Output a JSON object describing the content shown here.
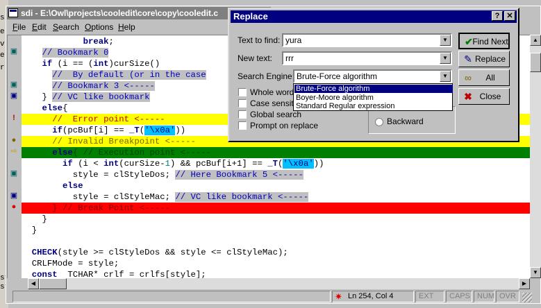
{
  "window": {
    "title": "sdi - E:\\Owl\\projects\\cooledit\\core\\copy\\cooledit.c"
  },
  "menu": {
    "items": [
      "File",
      "Edit",
      "Search",
      "Options",
      "Help"
    ],
    "underline": [
      "F",
      "E",
      "S",
      "O",
      "H"
    ]
  },
  "desktop_fragments": [
    "s",
    "e",
    "v",
    "e",
    "r",
    "st",
    "st"
  ],
  "editor": {
    "lines": [
      "            break;",
      "    // Bookmark 0",
      "    if (i == (int)curSize()",
      "      //  By default (or in the case",
      "      // Bookmark 3 <-----",
      "    } // VC like bookmark",
      "    else{",
      "      //  Error point <-----",
      "      if(pcBuf[i] == _T('\\x0a'))",
      "      // Invalid Breakpoint <-----",
      "      else{ // Execution point <-----",
      "        if (i < int(curSize-1) && pcBuf[i+1] == _T('\\x0a'))",
      "          style = clStyleDos; // Here Bookmark 5 <-----",
      "        else",
      "          style = clStyleMac; // VC like bookmark <-----",
      "      } // Break Point <-----",
      "    }",
      "  }",
      "",
      "  CHECK(style >= clStyleDos && style <= clStyleMac);",
      "  CRLFMode = style;",
      "  const  TCHAR* crlf = crlfs[style];"
    ]
  },
  "status": {
    "position": "Ln 254, Col 4",
    "indicators": [
      "EXT",
      "CAPS",
      "NUM",
      "OVR"
    ]
  },
  "dialog": {
    "title": "Replace",
    "help_glyph": "?",
    "close_glyph": "✕",
    "find_label": "Text to find:",
    "find_value": "yura",
    "new_label": "New text:",
    "new_value": "rrr",
    "engine_label": "Search Engine:",
    "engine_value": "Brute-Force algorithm",
    "engine_options": [
      "Brute-Force algorithm",
      "Boyer-Moore algorithm",
      "Standard Regular expression"
    ],
    "checkboxes": [
      "Whole words",
      "Case sensitiv",
      "Global search",
      "Prompt on replace"
    ],
    "direction_backward": "Backward",
    "buttons": {
      "find_next": "Find Next",
      "replace": "Replace",
      "all": "All",
      "close": "Close"
    }
  },
  "colors": {
    "error_line": "#ffff00",
    "execution_line": "#008000",
    "break_line": "#ff0000",
    "title_active": "#000080",
    "title_inactive": "#808080"
  }
}
